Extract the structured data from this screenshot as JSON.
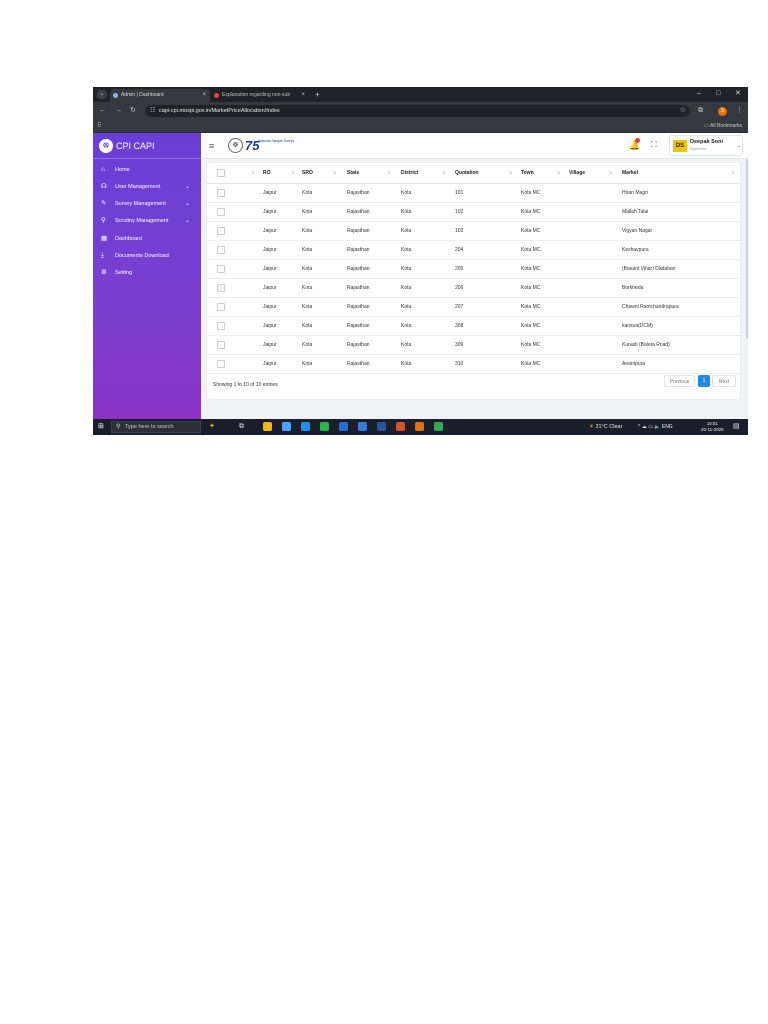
{
  "browser": {
    "tabs": [
      {
        "title": "Admin | Dashboard",
        "close": "×",
        "favicon_color": "#8ab4f8"
      },
      {
        "title": "Explanation regarding non-sub",
        "close": "×",
        "favicon_color": "#ea4335"
      }
    ],
    "menu_glyph": "⌄",
    "new_tab": "+",
    "window_controls": {
      "minimize": "–",
      "maximize": "□",
      "close": "✕"
    },
    "nav": {
      "back": "←",
      "forward": "→",
      "reload": "↻"
    },
    "url": "capi-cpi.mospi.gov.in/MarketPriceAllocation/Index",
    "tune_glyph": "☷",
    "star_glyph": "☆",
    "ext_glyph": "⧉",
    "profile_initial": "S",
    "more_glyph": "⋮",
    "apps_glyph": "⠿",
    "all_bookmarks": "All Bookmarks",
    "folder_glyph": "▭"
  },
  "sidebar": {
    "brand": "CPI CAPI",
    "logo_glyph": "☸",
    "items": [
      {
        "label": "Home",
        "icon": "⌂",
        "chevron": ""
      },
      {
        "label": "User Management",
        "icon": "☊",
        "chevron": "⌄"
      },
      {
        "label": "Survey Management",
        "icon": "✎",
        "chevron": "⌄"
      },
      {
        "label": "Scrutiny Management",
        "icon": "⚲",
        "chevron": "⌄"
      },
      {
        "label": "Dashboard",
        "icon": "▦",
        "chevron": ""
      },
      {
        "label": "Documents Download",
        "icon": "⤓",
        "chevron": ""
      },
      {
        "label": "Setting",
        "icon": "⚙",
        "chevron": ""
      }
    ]
  },
  "header": {
    "hamburger": "≡",
    "emblem_glyph": "☸",
    "nss_number": "75",
    "nss_text": "National Sample Survey",
    "bell_glyph": "🔔",
    "fullscreen_glyph": "⛶",
    "user": {
      "initials": "DS",
      "name": "Deepak Soni",
      "role": "Supervisor",
      "chevron": "⌄"
    }
  },
  "table": {
    "sort_glyph": "⇅",
    "headers": [
      "RO",
      "SRO",
      "State",
      "District",
      "Quotation",
      "Town",
      "Village",
      "Market"
    ],
    "rows": [
      {
        "ro": "Jaipur",
        "sro": "Kota",
        "state": "Rajasthan",
        "district": "Kota",
        "quotation": "101",
        "town": "Kota MC",
        "village": "",
        "market": "Hiran Magri"
      },
      {
        "ro": "Jaipur",
        "sro": "Kota",
        "state": "Rajasthan",
        "district": "Kota",
        "quotation": "102",
        "town": "Kota MC",
        "village": "",
        "market": "Mallah Talai"
      },
      {
        "ro": "Jaipur",
        "sro": "Kota",
        "state": "Rajasthan",
        "district": "Kota",
        "quotation": "103",
        "town": "Kota MC",
        "village": "",
        "market": "Vigyan Nagar"
      },
      {
        "ro": "Jaipur",
        "sro": "Kota",
        "state": "Rajasthan",
        "district": "Kota",
        "quotation": "204",
        "town": "Kota MC",
        "village": "",
        "market": "Keshavpura"
      },
      {
        "ro": "Jaipur",
        "sro": "Kota",
        "state": "Rajasthan",
        "district": "Kota",
        "quotation": "205",
        "town": "Kota MC",
        "village": "",
        "market": "(Basant Vihar) Dadabari"
      },
      {
        "ro": "Jaipur",
        "sro": "Kota",
        "state": "Rajasthan",
        "district": "Kota",
        "quotation": "206",
        "town": "Kota MC",
        "village": "",
        "market": "Borkheda"
      },
      {
        "ro": "Jaipur",
        "sro": "Kota",
        "state": "Rajasthan",
        "district": "Kota",
        "quotation": "207",
        "town": "Kota MC",
        "village": "",
        "market": "Chawni Ramchandrapura"
      },
      {
        "ro": "Jaipur",
        "sro": "Kota",
        "state": "Rajasthan",
        "district": "Kota",
        "quotation": "308",
        "town": "Kota MC",
        "village": "",
        "market": "kansua(DCM)"
      },
      {
        "ro": "Jaipur",
        "sro": "Kota",
        "state": "Rajasthan",
        "district": "Kota",
        "quotation": "309",
        "town": "Kota MC",
        "village": "",
        "market": "Kunadi (Baleta Road)"
      },
      {
        "ro": "Jaipur",
        "sro": "Kota",
        "state": "Rajasthan",
        "district": "Kota",
        "quotation": "310",
        "town": "Kota MC",
        "village": "",
        "market": "Anantpura"
      }
    ],
    "info": "Showing 1 to 10 of 10 entries",
    "pagination": {
      "previous": "Previous",
      "current": "1",
      "next": "Next"
    }
  },
  "taskbar": {
    "start_glyph": "⊞",
    "search_glyph": "⚲",
    "search_placeholder": "Type here to search",
    "copilot_glyph": "✦",
    "taskview_glyph": "⧉",
    "weather": "21°C  Clear",
    "weather_glyph": "☀",
    "tray": "^  ☁  ▭  🔈  ENG",
    "time": "16:51",
    "date": "20-11-2025",
    "notif_glyph": "▤",
    "app_colors": [
      "#f2b705",
      "#4aa3ff",
      "#1f8fff",
      "#2fb350",
      "#1e6fd9",
      "#3c78d8",
      "#2b579a",
      "#d35230",
      "#e8710a",
      "#34a853"
    ]
  }
}
